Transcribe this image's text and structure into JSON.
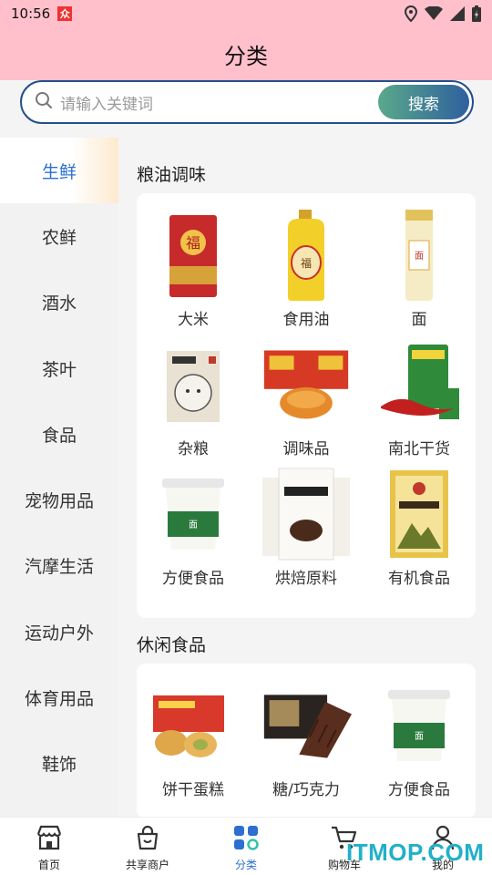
{
  "status_bar": {
    "time": "10:56",
    "app_mark": "众"
  },
  "header": {
    "title": "分类"
  },
  "search": {
    "placeholder": "请输入关键词",
    "button": "搜索"
  },
  "sidebar": {
    "items": [
      {
        "label": "生鲜",
        "active": true
      },
      {
        "label": "农鲜"
      },
      {
        "label": "酒水"
      },
      {
        "label": "茶叶"
      },
      {
        "label": "食品"
      },
      {
        "label": "宠物用品"
      },
      {
        "label": "汽摩生活"
      },
      {
        "label": "运动户外"
      },
      {
        "label": "体育用品"
      },
      {
        "label": "鞋饰"
      }
    ]
  },
  "sections": [
    {
      "title": "粮油调味",
      "items": [
        {
          "label": "大米",
          "icon": "rice-bag-icon"
        },
        {
          "label": "食用油",
          "icon": "oil-bottle-icon"
        },
        {
          "label": "面",
          "icon": "noodle-pack-icon"
        },
        {
          "label": "杂粮",
          "icon": "grain-bag-icon"
        },
        {
          "label": "调味品",
          "icon": "seasoning-box-icon"
        },
        {
          "label": "南北干货",
          "icon": "dried-goods-icon"
        },
        {
          "label": "方便食品",
          "icon": "instant-noodle-cup-icon"
        },
        {
          "label": "烘焙原料",
          "icon": "flour-bag-icon"
        },
        {
          "label": "有机食品",
          "icon": "organic-bag-icon"
        }
      ]
    },
    {
      "title": "休闲食品",
      "items": [
        {
          "label": "饼干蛋糕",
          "icon": "cake-box-icon"
        },
        {
          "label": "糖/巧克力",
          "icon": "chocolate-icon"
        },
        {
          "label": "方便食品",
          "icon": "instant-noodle-cup-icon"
        }
      ]
    }
  ],
  "bottom_nav": [
    {
      "label": "首页",
      "icon": "store-icon"
    },
    {
      "label": "共享商户",
      "icon": "shopping-bag-icon"
    },
    {
      "label": "分类",
      "icon": "category-icon",
      "active": true
    },
    {
      "label": "购物车",
      "icon": "cart-icon"
    },
    {
      "label": "我的",
      "icon": "person-icon"
    }
  ],
  "watermark": "ITMOP.COM"
}
